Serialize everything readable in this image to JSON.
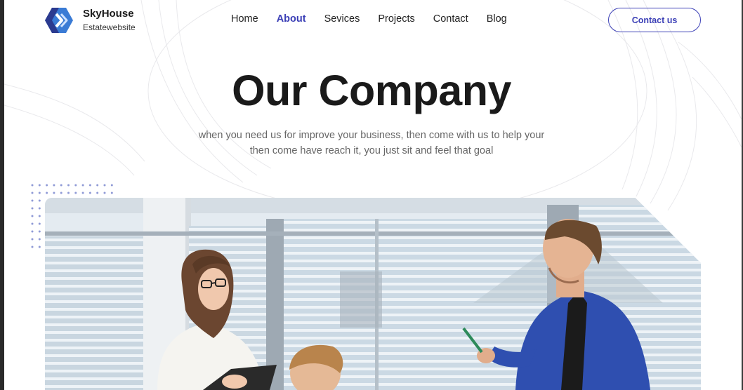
{
  "brand": {
    "name": "SkyHouse",
    "subtitle": "Estatewebsite",
    "logo_icon": "hexagon-chevron-logo-icon"
  },
  "nav": {
    "items": [
      {
        "label": "Home",
        "active": false
      },
      {
        "label": "About",
        "active": true
      },
      {
        "label": "Sevices",
        "active": false
      },
      {
        "label": "Projects",
        "active": false
      },
      {
        "label": "Contact",
        "active": false
      },
      {
        "label": "Blog",
        "active": false
      }
    ]
  },
  "header": {
    "cta_label": "Contact us"
  },
  "hero": {
    "title": "Our Company",
    "subtitle": "when you need us for improve your business, then come with us to help your then come have reach it, you just sit and feel that goal"
  },
  "image": {
    "subject": "office-meeting-photo"
  },
  "colors": {
    "accent": "#3b3fb6",
    "logo_blue": "#3a7bd5",
    "logo_dark": "#2b3a8f",
    "text_dark": "#1a1a1a",
    "text_muted": "#666666",
    "dots": "#8f9ad6"
  }
}
